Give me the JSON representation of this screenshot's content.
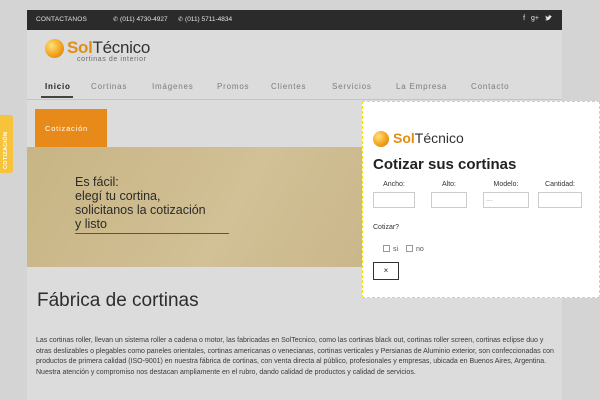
{
  "topbar": {
    "contact": "CONTACTANOS",
    "phone1": "(011) 4730-4927",
    "phone2": "(011) 5711-4834",
    "social": [
      "f",
      "g+",
      "t"
    ]
  },
  "brand": {
    "sol": "Sol",
    "tecnico": "Técnico",
    "tagline": "cortinas de interior"
  },
  "nav": [
    "Inicio",
    "Cortinas",
    "Imágenes",
    "Promos",
    "Clientes",
    "Servicios",
    "La Empresa",
    "Contacto"
  ],
  "cotizacion_button": "Cotización",
  "hero": {
    "line1": "Es fácil:",
    "line2": "elegí tu cortina,",
    "line3": "solicitanos la cotización",
    "line4": "y listo"
  },
  "heading": "Fábrica de cortinas",
  "paragraph": "Las cortinas roller, llevan un sistema roller a cadena o motor, las fabricadas en SolTecnico, como las cortinas black out, cortinas roller screen, cortinas eclipse duo y otras deslizables o plegables como paneles orientales, cortinas americanas o venecianas, cortinas verticales y Persianas de Aluminio exterior, son confeccionadas con productos de primera calidad (ISO-9001) en nuestra fábrica de cortinas, con venta directa al público, profesionales y empresas, ubicada en Buenos Aires, Argentina. Nuestra atención y compromiso nos destacan ampliamente en el rubro, dando calidad de productos y calidad de servicios.",
  "side_tab": "COTIZACIÓN",
  "modal": {
    "title": "Cotizar sus cortinas",
    "fields": [
      {
        "label": "Ancho:",
        "value": ""
      },
      {
        "label": "Alto:",
        "value": ""
      },
      {
        "label": "Modelo:",
        "value": "----"
      },
      {
        "label": "Cantidad:",
        "value": ""
      }
    ],
    "question": "Cotizar?",
    "options": [
      "si",
      "no"
    ],
    "close": "×"
  }
}
